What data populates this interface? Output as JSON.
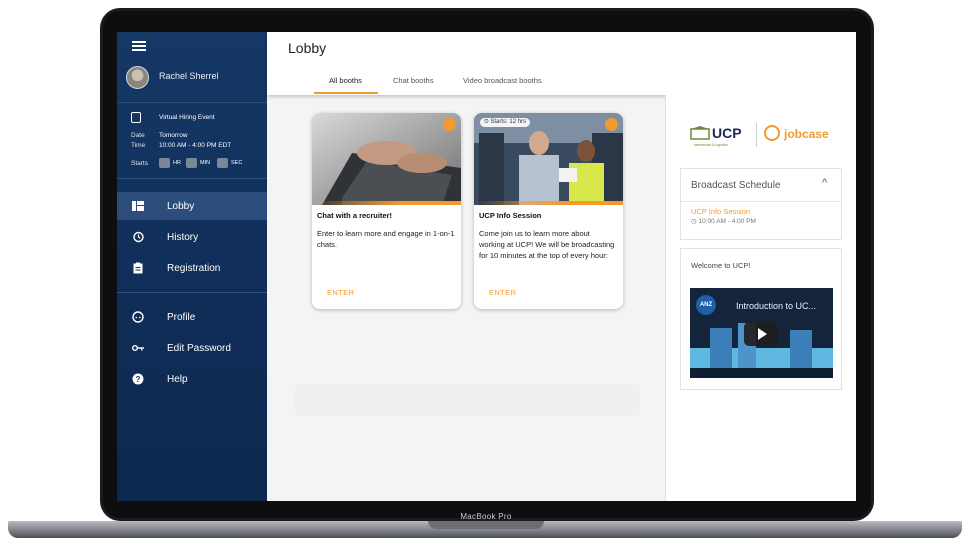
{
  "device": {
    "label": "MacBook Pro"
  },
  "sidebar": {
    "user_name": "Rachel Sherrel",
    "event": {
      "title": "Virtual Hiring Event",
      "date_label": "Date",
      "date_value": "Tomorrow",
      "time_label": "Time",
      "time_value": "10:00 AM - 4:00 PM EDT",
      "starts_label": "Starts",
      "countdown": {
        "hr_label": "HR",
        "min_label": "MIN",
        "sec_label": "SEC"
      }
    },
    "nav": [
      {
        "label": "Lobby",
        "icon": "lobby-icon",
        "active": true
      },
      {
        "label": "History",
        "icon": "history-icon",
        "active": false
      },
      {
        "label": "Registration",
        "icon": "clipboard-icon",
        "active": false
      },
      {
        "label": "Profile",
        "icon": "face-icon",
        "active": false
      },
      {
        "label": "Edit Password",
        "icon": "key-icon",
        "active": false
      },
      {
        "label": "Help",
        "icon": "help-icon",
        "active": false
      }
    ]
  },
  "header": {
    "title": "Lobby",
    "tabs": [
      {
        "label": "All booths",
        "active": true
      },
      {
        "label": "Chat booths",
        "active": false
      },
      {
        "label": "Video broadcast booths",
        "active": false
      }
    ]
  },
  "booths": [
    {
      "title": "Chat with a recruiter!",
      "description": "Enter to learn more and engage in 1-on-1 chats.",
      "cta": "ENTER",
      "badge_icon": "chat-icon"
    },
    {
      "title": "UCP Info Session",
      "description": "Come join us to learn more about working at UCP!  We will be broadcasting for 10 minutes at the top of every hour:",
      "cta": "ENTER",
      "starts_chip": "Starts: 12 hrs",
      "badge_icon": "video-icon"
    }
  ],
  "right_panel": {
    "logos": {
      "ucp": "UCP",
      "ucp_tagline": "warehouse & logistics",
      "jobcase": "jobcase"
    },
    "broadcast_schedule": {
      "title": "Broadcast Schedule",
      "item_title": "UCP Info Session",
      "item_time": "10:00 AM - 4:00 PM"
    },
    "welcome": {
      "text": "Welcome to UCP!",
      "video_title": "Introduction to UC...",
      "video_logo": "ANZ"
    }
  },
  "colors": {
    "sidebar": "#0f2d57",
    "accent": "#f29a2e",
    "active_nav": "#2c4d7b"
  }
}
